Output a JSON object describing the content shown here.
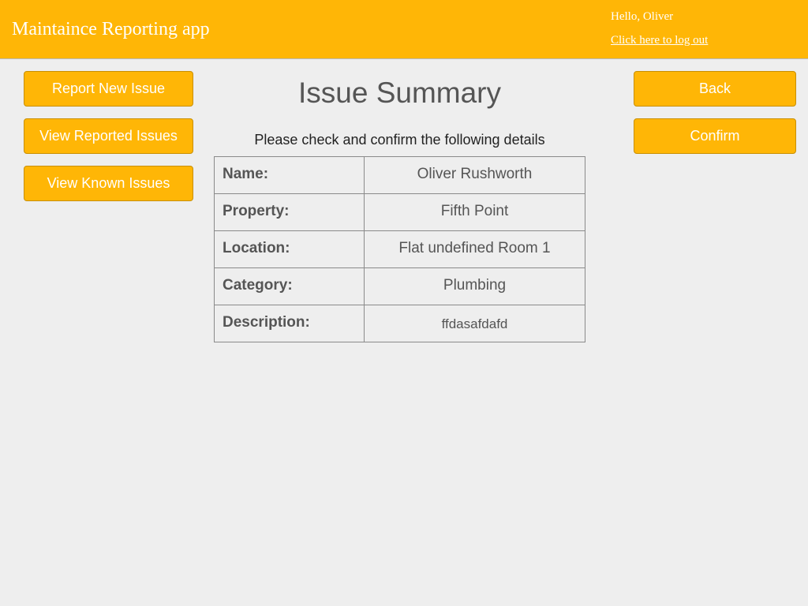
{
  "header": {
    "app_title": "Maintaince Reporting app",
    "greeting": "Hello, Oliver",
    "logout_label": "Click here to log out"
  },
  "nav": {
    "report_new_issue": "Report New Issue",
    "view_reported_issues": "View Reported Issues",
    "view_known_issues": "View Known Issues"
  },
  "actions": {
    "back_label": "Back",
    "confirm_label": "Confirm"
  },
  "main": {
    "title": "Issue Summary",
    "instructions": "Please check and confirm the following details",
    "rows": [
      {
        "label": "Name:",
        "value": "Oliver Rushworth"
      },
      {
        "label": "Property:",
        "value": "Fifth Point"
      },
      {
        "label": "Location:",
        "value": "Flat undefined Room 1"
      },
      {
        "label": "Category:",
        "value": "Plumbing"
      },
      {
        "label": "Description:",
        "value": "ffdasafdafd"
      }
    ]
  },
  "colors": {
    "accent": "#ffb606",
    "background": "#eeeeee",
    "text": "#555555"
  }
}
